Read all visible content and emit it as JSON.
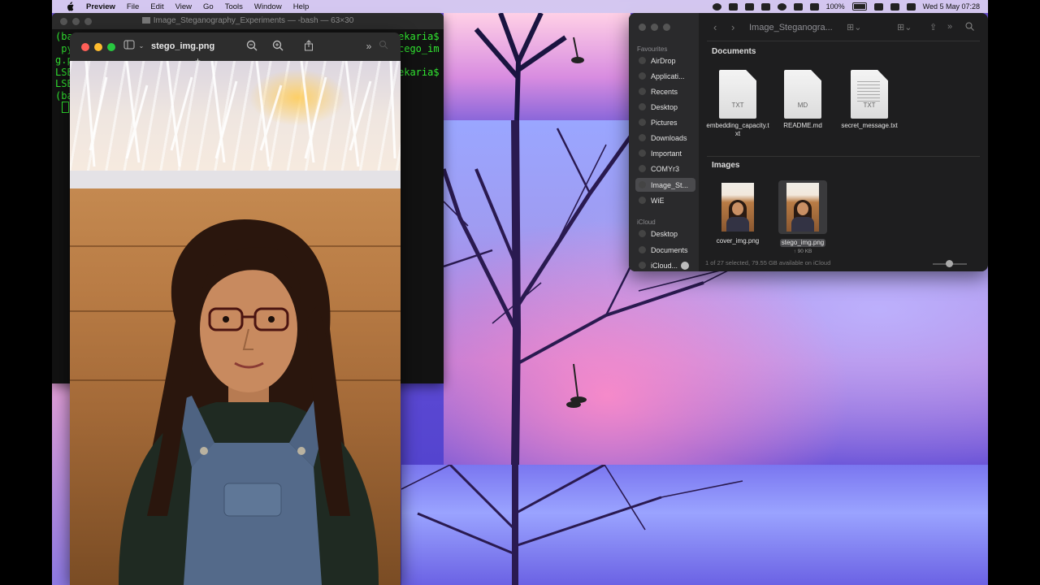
{
  "menubar": {
    "app_name": "Preview",
    "menus": [
      "File",
      "Edit",
      "View",
      "Go",
      "Tools",
      "Window",
      "Help"
    ],
    "battery": "100%",
    "datetime": "Wed 5 May  07:28"
  },
  "terminal": {
    "title": "Image_Steganography_Experiments — -bash — 63×30",
    "lines_left": [
      "(ba",
      " py",
      "g.p",
      "LSB",
      "LSB",
      "(ba",
      " "
    ],
    "lines_right": [
      "ekaria$",
      "cego_im",
      "",
      "ekaria$"
    ]
  },
  "preview": {
    "title": "stego_img.png"
  },
  "finder": {
    "title": "Image_Steganogra...",
    "sidebar": {
      "favourites_header": "Favourites",
      "favourites": [
        "AirDrop",
        "Applicati...",
        "Recents",
        "Desktop",
        "Pictures",
        "Downloads",
        "Important",
        "COMYr3",
        "Image_St...",
        "WiE"
      ],
      "icloud_header": "iCloud",
      "icloud": [
        "Desktop",
        "Documents",
        "iCloud..."
      ]
    },
    "documents_header": "Documents",
    "documents": [
      {
        "name": "embedding_capacity.txt",
        "ext": "TXT"
      },
      {
        "name": "README.md",
        "ext": "MD"
      },
      {
        "name": "secret_message.txt",
        "ext": "TXT"
      }
    ],
    "images_header": "Images",
    "images": [
      {
        "name": "cover_img.png",
        "size": ""
      },
      {
        "name": "stego_img.png",
        "size": "↑ 90 KB"
      }
    ],
    "status": "1 of 27 selected, 79.55 GB available on iCloud"
  },
  "colors": {
    "terminal_text": "#31e831",
    "close": "#ff5f57",
    "minimize": "#febc2e",
    "zoom": "#28c840"
  }
}
